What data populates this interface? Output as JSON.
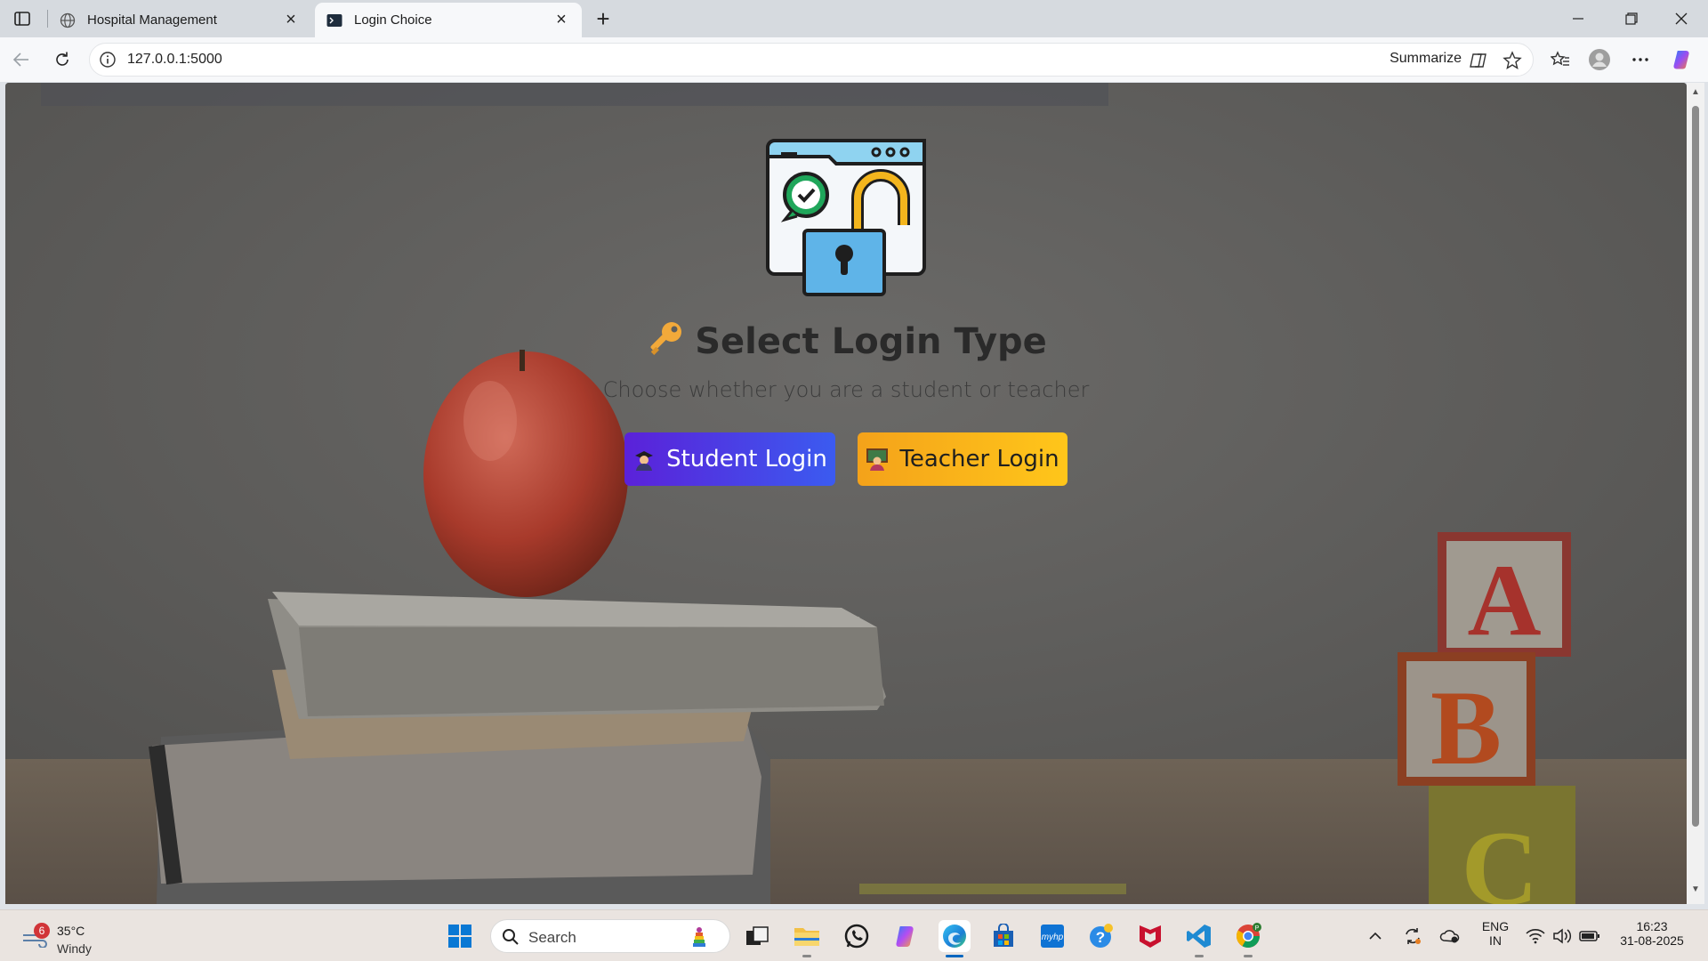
{
  "browser": {
    "tabs": [
      {
        "title": "Hospital Management",
        "favicon": "globe-icon",
        "active": false
      },
      {
        "title": "Login Choice",
        "favicon": "terminal-icon",
        "active": true
      }
    ],
    "address": "127.0.0.1:5000",
    "summarize_label": "Summarize"
  },
  "page": {
    "heading": "Select Login Type",
    "heading_icon": "key-icon",
    "subtitle": "Choose whether you are a student or teacher",
    "student_button": "Student Login",
    "teacher_button": "Teacher Login",
    "colors": {
      "student_gradient_start": "#5b21d9",
      "student_gradient_end": "#3b5bf0",
      "teacher_gradient_start": "#f4a21a",
      "teacher_gradient_end": "#ffc61a"
    }
  },
  "taskbar": {
    "weather": {
      "temp": "35°C",
      "condition": "Windy",
      "badge": "6"
    },
    "search_label": "Search",
    "language": {
      "line1": "ENG",
      "line2": "IN"
    },
    "clock": {
      "time": "16:23",
      "date": "31-08-2025"
    }
  }
}
